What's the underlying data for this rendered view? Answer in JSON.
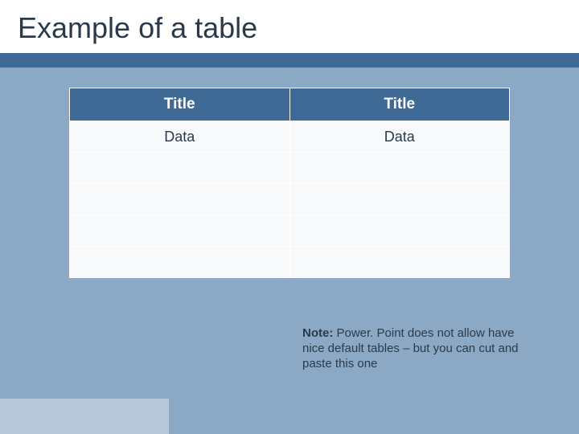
{
  "slide": {
    "title": "Example of a table"
  },
  "table": {
    "headers": [
      "Title",
      "Title"
    ],
    "rows": [
      [
        "Data",
        "Data"
      ],
      [
        "",
        ""
      ],
      [
        "",
        ""
      ],
      [
        "",
        ""
      ],
      [
        "",
        ""
      ]
    ]
  },
  "note": {
    "label": "Note:",
    "text": " Power. Point does not allow have nice default tables – but you can cut and paste this one"
  }
}
